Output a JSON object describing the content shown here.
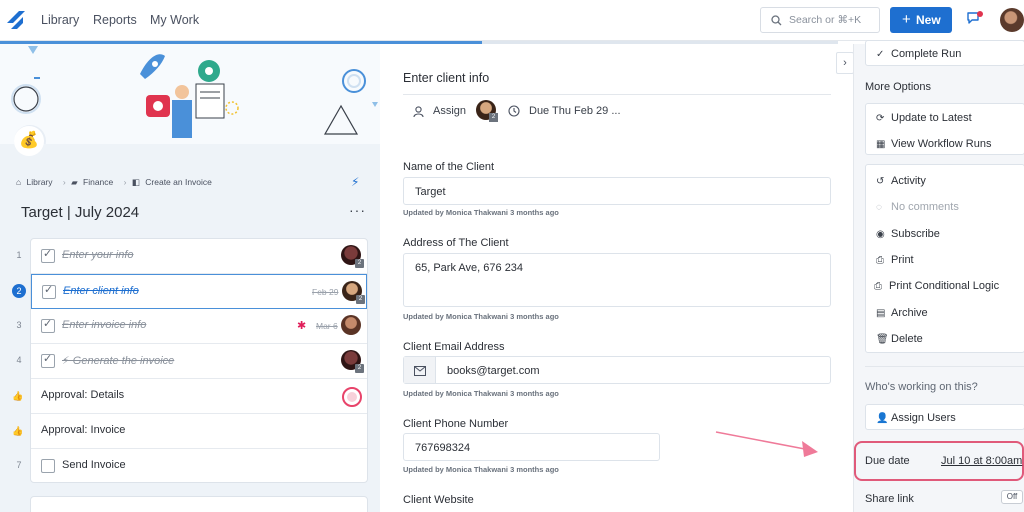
{
  "nav": {
    "items": [
      "Library",
      "Reports",
      "My Work"
    ],
    "search_placeholder": "Search or ⌘+K",
    "new_button": "New",
    "progress_fraction": 0.575
  },
  "left": {
    "breadcrumb": [
      "Library",
      "Finance",
      "Create an Invoice"
    ],
    "run_title": "Target | July 2024",
    "tasks": [
      {
        "num": "1",
        "label": "Enter your info",
        "done": true,
        "date": ""
      },
      {
        "num": "2",
        "label": "Enter client info",
        "done": true,
        "date": "Feb 29",
        "current": true
      },
      {
        "num": "3",
        "label": "Enter invoice info",
        "done": true,
        "date": "Mar 6"
      },
      {
        "num": "4",
        "label": "⚡ Generate the invoice",
        "done": true,
        "date": ""
      },
      {
        "num": "",
        "label": "Approval: Details",
        "done": false
      },
      {
        "num": "",
        "label": "Approval: Invoice",
        "done": false
      },
      {
        "num": "7",
        "label": "Send Invoice",
        "done": false
      }
    ],
    "badge": "2"
  },
  "step": {
    "title": "Enter client info",
    "assign_label": "Assign",
    "due_text": "Due Thu Feb 29 ...",
    "fields": [
      {
        "label": "Name of the Client",
        "value": "Target",
        "meta": "Updated by Monica Thakwani 3 months ago"
      },
      {
        "label": "Address of The Client",
        "value": "65, Park Ave, 676 234",
        "meta": "Updated by Monica Thakwani 3 months ago"
      },
      {
        "label": "Client Email Address",
        "value": "books@target.com",
        "meta": "Updated by Monica Thakwani 3 months ago"
      },
      {
        "label": "Client Phone Number",
        "value": "767698324",
        "meta": "Updated by Monica Thakwani 3 months ago"
      },
      {
        "label": "Client Website",
        "value": "",
        "meta": ""
      }
    ]
  },
  "sidebar": {
    "complete_run": "Complete Run",
    "more_options": "More Options",
    "update_latest": "Update to Latest",
    "view_runs": "View Workflow Runs",
    "activity": "Activity",
    "no_comments": "No comments",
    "subscribe": "Subscribe",
    "print": "Print",
    "print_logic": "Print Conditional Logic",
    "archive": "Archive",
    "delete": "Delete",
    "working_on": "Who's working on this?",
    "assign_users": "Assign Users",
    "due_date_label": "Due date",
    "due_date_value": "Jul 10 at 8:00am",
    "share_link": "Share link",
    "share_toggle": "Off"
  },
  "colors": {
    "accent": "#1e6fd0",
    "highlight": "#e05a7a"
  }
}
